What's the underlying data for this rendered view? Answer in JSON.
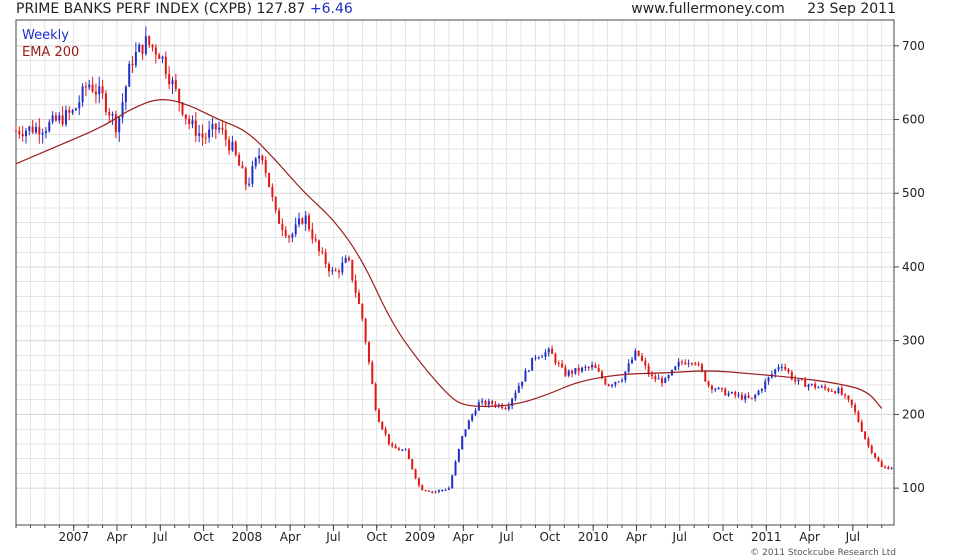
{
  "header": {
    "title": "PRIME BANKS PERF INDEX (CXPB)",
    "last": "127.87",
    "change": "+6.46",
    "source": "www.fullermoney.com",
    "date": "23 Sep 2011"
  },
  "legend": {
    "weekly": "Weekly",
    "ema": "EMA 200"
  },
  "copyright": "© 2011 Stockcube Research Ltd",
  "colors": {
    "up": "#1f2fc8",
    "down": "#e01818",
    "ema": "#9b1c1c",
    "grid": "#d6d6d6",
    "axis": "#444444"
  },
  "chart_data": {
    "type": "line",
    "subtype": "weekly candlestick (high-low bars) with exponential moving average",
    "x_range": [
      "2006-09",
      "2011-09"
    ],
    "x_ticks": [
      "2007",
      "Apr",
      "Jul",
      "Oct",
      "2008",
      "Apr",
      "Jul",
      "Oct",
      "2009",
      "Apr",
      "Jul",
      "Oct",
      "2010",
      "Apr",
      "Jul",
      "Oct",
      "2011",
      "Apr",
      "Jul"
    ],
    "x_tick_dates": [
      "2007-01",
      "2007-04",
      "2007-07",
      "2007-10",
      "2008-01",
      "2008-04",
      "2008-07",
      "2008-10",
      "2009-01",
      "2009-04",
      "2009-07",
      "2009-10",
      "2010-01",
      "2010-04",
      "2010-07",
      "2010-10",
      "2011-01",
      "2011-04",
      "2011-07"
    ],
    "y_axis": {
      "ticks": [
        100,
        200,
        300,
        400,
        500,
        600,
        700
      ],
      "ylim": [
        50,
        735
      ],
      "side": "right"
    },
    "grid": true,
    "legend_position": "top-left",
    "series": [
      {
        "name": "Weekly",
        "points": [
          [
            "2006-09",
            585
          ],
          [
            "2006-11",
            590
          ],
          [
            "2007-01",
            610
          ],
          [
            "2007-02",
            650
          ],
          [
            "2007-03",
            630
          ],
          [
            "2007-04",
            590
          ],
          [
            "2007-05",
            680
          ],
          [
            "2007-06",
            705
          ],
          [
            "2007-07",
            690
          ],
          [
            "2007-08",
            640
          ],
          [
            "2007-09",
            595
          ],
          [
            "2007-10",
            575
          ],
          [
            "2007-11",
            590
          ],
          [
            "2007-12",
            560
          ],
          [
            "2008-01",
            510
          ],
          [
            "2008-02",
            560
          ],
          [
            "2008-03",
            470
          ],
          [
            "2008-04",
            440
          ],
          [
            "2008-05",
            470
          ],
          [
            "2008-06",
            420
          ],
          [
            "2008-07",
            390
          ],
          [
            "2008-08",
            410
          ],
          [
            "2008-09",
            330
          ],
          [
            "2008-10",
            200
          ],
          [
            "2008-11",
            155
          ],
          [
            "2008-12",
            150
          ],
          [
            "2009-01",
            100
          ],
          [
            "2009-02",
            95
          ],
          [
            "2009-03",
            100
          ],
          [
            "2009-04",
            175
          ],
          [
            "2009-05",
            215
          ],
          [
            "2009-06",
            215
          ],
          [
            "2009-07",
            210
          ],
          [
            "2009-08",
            245
          ],
          [
            "2009-09",
            280
          ],
          [
            "2009-10",
            285
          ],
          [
            "2009-11",
            255
          ],
          [
            "2009-12",
            260
          ],
          [
            "2010-01",
            265
          ],
          [
            "2010-02",
            240
          ],
          [
            "2010-03",
            250
          ],
          [
            "2010-04",
            285
          ],
          [
            "2010-05",
            250
          ],
          [
            "2010-06",
            245
          ],
          [
            "2010-07",
            270
          ],
          [
            "2010-08",
            275
          ],
          [
            "2010-09",
            240
          ],
          [
            "2010-10",
            230
          ],
          [
            "2010-11",
            225
          ],
          [
            "2010-12",
            220
          ],
          [
            "2011-01",
            245
          ],
          [
            "2011-02",
            270
          ],
          [
            "2011-03",
            245
          ],
          [
            "2011-04",
            240
          ],
          [
            "2011-05",
            235
          ],
          [
            "2011-06",
            232
          ],
          [
            "2011-07",
            210
          ],
          [
            "2011-08",
            160
          ],
          [
            "2011-09",
            128
          ]
        ]
      },
      {
        "name": "EMA 200",
        "points": [
          [
            "2006-09",
            540
          ],
          [
            "2006-12",
            565
          ],
          [
            "2007-03",
            590
          ],
          [
            "2007-05",
            615
          ],
          [
            "2007-07",
            630
          ],
          [
            "2007-09",
            620
          ],
          [
            "2007-11",
            600
          ],
          [
            "2008-01",
            585
          ],
          [
            "2008-03",
            545
          ],
          [
            "2008-05",
            500
          ],
          [
            "2008-07",
            465
          ],
          [
            "2008-09",
            410
          ],
          [
            "2008-11",
            325
          ],
          [
            "2009-01",
            270
          ],
          [
            "2009-03",
            225
          ],
          [
            "2009-04",
            212
          ],
          [
            "2009-06",
            210
          ],
          [
            "2009-08",
            215
          ],
          [
            "2009-10",
            228
          ],
          [
            "2009-12",
            245
          ],
          [
            "2010-03",
            255
          ],
          [
            "2010-06",
            256
          ],
          [
            "2010-09",
            260
          ],
          [
            "2010-12",
            255
          ],
          [
            "2011-03",
            250
          ],
          [
            "2011-06",
            242
          ],
          [
            "2011-08",
            232
          ],
          [
            "2011-09",
            208
          ]
        ]
      }
    ]
  }
}
